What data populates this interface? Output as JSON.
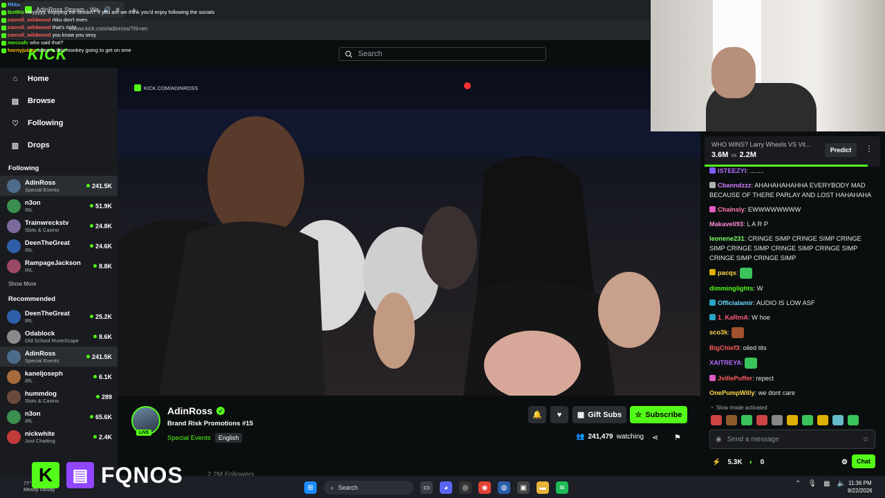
{
  "browser": {
    "tab_title": "AdinRoss Stream - Watch Li",
    "url_text": "www.kick.com/adinross/?hl=en"
  },
  "overlay_chat": [
    {
      "user": "Rkku",
      "text": "",
      "color": "#5aa0ff"
    },
    {
      "user": "BotRix",
      "text": "Heyyyyy, enjoying the stream? If you are we think you'd enjoy following the socials",
      "color": "#53fc18"
    },
    {
      "user": "caeroll_wildwood",
      "text": "rkku don't even",
      "color": "#ff5b5b"
    },
    {
      "user": "caeroll_wildwood",
      "text": "that's right",
      "color": "#ff5b5b"
    },
    {
      "user": "caeroll_wildwood",
      "text": "you know you sexy",
      "color": "#ff5b5b"
    },
    {
      "user": "meccafc",
      "text": "who said that?",
      "color": "#53fc18"
    },
    {
      "user": "hornyjuicer",
      "text": "when is this monkey going to get on ome",
      "color": "#ffc400"
    }
  ],
  "header": {
    "logo": "KICK",
    "search_placeholder": "Search"
  },
  "sidebar": {
    "nav": [
      {
        "label": "Home",
        "icon": "home-icon",
        "glyph": "⌂"
      },
      {
        "label": "Browse",
        "icon": "browse-icon",
        "glyph": "▤"
      },
      {
        "label": "Following",
        "icon": "heart-icon",
        "glyph": "♡"
      },
      {
        "label": "Drops",
        "icon": "drops-icon",
        "glyph": "▥"
      }
    ],
    "following_title": "Following",
    "following": [
      {
        "name": "AdinRoss",
        "category": "Special Events",
        "viewers": "241.5K",
        "color": "#4d6b8a",
        "active": true
      },
      {
        "name": "n3on",
        "category": "IRL",
        "viewers": "51.9K",
        "color": "#3a8f4f",
        "active": false
      },
      {
        "name": "Trainwreckstv",
        "category": "Slots & Casino",
        "viewers": "24.8K",
        "color": "#7c6b9e",
        "active": false
      },
      {
        "name": "DeenTheGreat",
        "category": "IRL",
        "viewers": "24.6K",
        "color": "#2f5fa8",
        "active": false
      },
      {
        "name": "RampageJackson",
        "category": "IRL",
        "viewers": "8.8K",
        "color": "#9b4a66",
        "active": false
      }
    ],
    "show_more": "Show More",
    "recommended_title": "Recommended",
    "recommended": [
      {
        "name": "DeenTheGreat",
        "category": "IRL",
        "viewers": "25.2K",
        "color": "#2f5fa8",
        "active": false
      },
      {
        "name": "Odablock",
        "category": "Old School RuneScape",
        "viewers": "8.6K",
        "color": "#8a8a8a",
        "active": false
      },
      {
        "name": "AdinRoss",
        "category": "Special Events",
        "viewers": "241.5K",
        "color": "#4d6b8a",
        "active": true
      },
      {
        "name": "kaneljoseph",
        "category": "IRL",
        "viewers": "6.1K",
        "color": "#a86a3a",
        "active": false
      },
      {
        "name": "hummdog",
        "category": "Slots & Casino",
        "viewers": "289",
        "color": "#6a4a3a",
        "active": false
      },
      {
        "name": "n3on",
        "category": "IRL",
        "viewers": "65.6K",
        "color": "#3a8f4f",
        "active": false
      },
      {
        "name": "nickwhite",
        "category": "Just Chatting",
        "viewers": "2.4K",
        "color": "#c23a3a",
        "active": false
      }
    ]
  },
  "video": {
    "watermark": "KICK.COM/ADINROSS"
  },
  "stream": {
    "name": "AdinRoss",
    "live_label": "LIVE",
    "title": "Brand Risk Promotions #15",
    "category": "Special Events",
    "language": "English",
    "gift_subs": "Gift Subs",
    "subscribe": "Subscribe",
    "watching_count": "241,479",
    "watching_label": "watching",
    "followers_count": "2.2M",
    "followers_label": "Followers"
  },
  "prediction": {
    "question": "WHO WINS? Larry Wheels VS Vit...",
    "left_value": "3.6M",
    "vs": "vs",
    "right_value": "2.2M",
    "button": "Predict",
    "left_fraction": 0.93
  },
  "chat": {
    "messages": [
      {
        "user": "ISTEEZYI",
        "text": "........",
        "color": "#b06cff",
        "badge": "#7c5cff"
      },
      {
        "user": "Cbanndzzz",
        "text": "AHAHAHAHAHHA EVERYBODY MAD BECAUSE OF THERE PARLAY AND LOST HAHAHAHA",
        "color": "#d27cff",
        "badge": "#b0b0b0"
      },
      {
        "user": "Chainsly",
        "text": "EWWWWWWWW",
        "color": "#ff7ab0",
        "badge": "#e05ac0"
      },
      {
        "user": "Makaveli93",
        "text": "L A R P",
        "color": "#ff8ad8",
        "badge": ""
      },
      {
        "user": "leonene231",
        "text": "CRINGE SIMP CRINGE SIMP CRINGE SIMP CRINGE SIMP CRINGE SIMP CRINGE SIMP CRINGE SIMP CRINGE SIMP",
        "color": "#7cff6b",
        "badge": ""
      },
      {
        "user": "pacqs",
        "text": "",
        "color": "#ffd84a",
        "badge": "#e0b000",
        "emote": "#39c35a"
      },
      {
        "user": "dimminglights",
        "text": "W",
        "color": "#53fc18",
        "badge": ""
      },
      {
        "user": "Officialamir",
        "text": "AUDIO IS LOW ASF",
        "color": "#6bd6ff",
        "badge": "#2aa6c8"
      },
      {
        "user": "1_KaRmA",
        "text": "W hoe",
        "color": "#ff5b7a",
        "badge": "#2aa6c8"
      },
      {
        "user": "sco3k",
        "text": "",
        "color": "#ffd84a",
        "badge": "",
        "emote": "#a0522d"
      },
      {
        "user": "BigChief3",
        "text": "oiled tits",
        "color": "#ff5b5b",
        "badge": ""
      },
      {
        "user": "XAITREYA",
        "text": "",
        "color": "#b06cff",
        "badge": "",
        "emote": "#39c35a"
      },
      {
        "user": "JvillePuffer",
        "text": "repect",
        "color": "#ff5b5b",
        "badge": "#e05ac0"
      },
      {
        "user": "OnePumpWilly",
        "text": "we dont care",
        "color": "#ffd84a",
        "badge": ""
      }
    ],
    "slow_mode": "Slow mode activated",
    "input_placeholder": "Send a message",
    "points": "5.3K",
    "kick_points": "0",
    "chat_button": "Chat",
    "emote_colors": [
      "#c44",
      "#8b5a2b",
      "#39c35a",
      "#c44",
      "#888",
      "#e0b000",
      "#39c35a",
      "#e0b000",
      "#6bc",
      "#39c35a"
    ]
  },
  "overlay_brand": {
    "k": "K",
    "name": "FQNOS"
  },
  "taskbar": {
    "weather_temp": "77°F",
    "weather_text": "Mostly cloudy",
    "search": "Search",
    "time": "11:36 PM",
    "date": "8/22/2026"
  }
}
